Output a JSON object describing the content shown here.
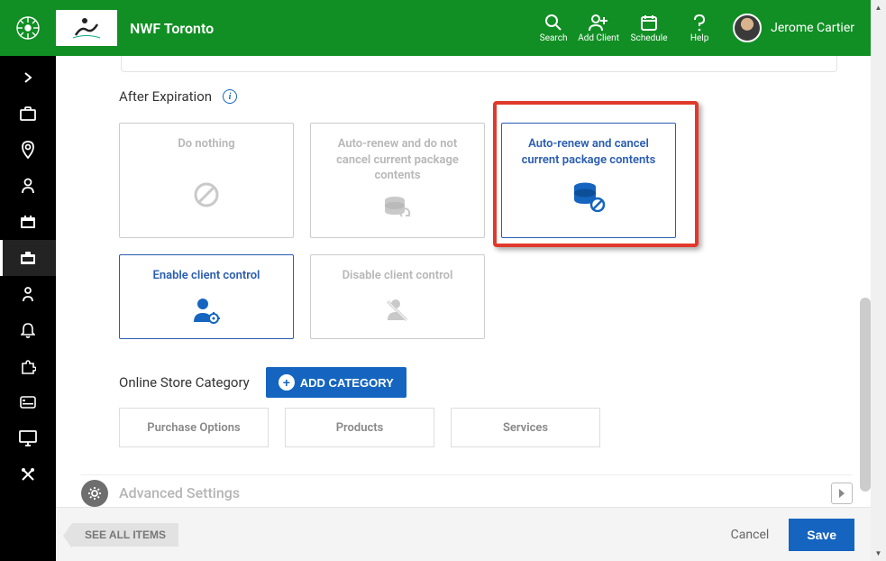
{
  "header": {
    "org_name": "NWF Toronto",
    "search_label": "Search",
    "add_client_label": "Add Client",
    "schedule_label": "Schedule",
    "help_label": "Help",
    "user_name": "Jerome Cartier"
  },
  "section": {
    "after_expiration_label": "After Expiration",
    "online_store_label": "Online Store Category",
    "add_category_label": "ADD CATEGORY",
    "advanced_label": "Advanced Settings"
  },
  "cards": {
    "do_nothing": "Do nothing",
    "auto_no_cancel": "Auto-renew and do not cancel current package contents",
    "auto_cancel": "Auto-renew and cancel current package contents",
    "enable_client": "Enable client control",
    "disable_client": "Disable client control"
  },
  "tabs": {
    "purchase": "Purchase Options",
    "products": "Products",
    "services": "Services"
  },
  "footer": {
    "see_all": "SEE ALL ITEMS",
    "cancel": "Cancel",
    "save": "Save"
  },
  "colors": {
    "brand_green": "#118f24",
    "primary_blue": "#1565c0",
    "highlight_red": "#e0392b"
  }
}
